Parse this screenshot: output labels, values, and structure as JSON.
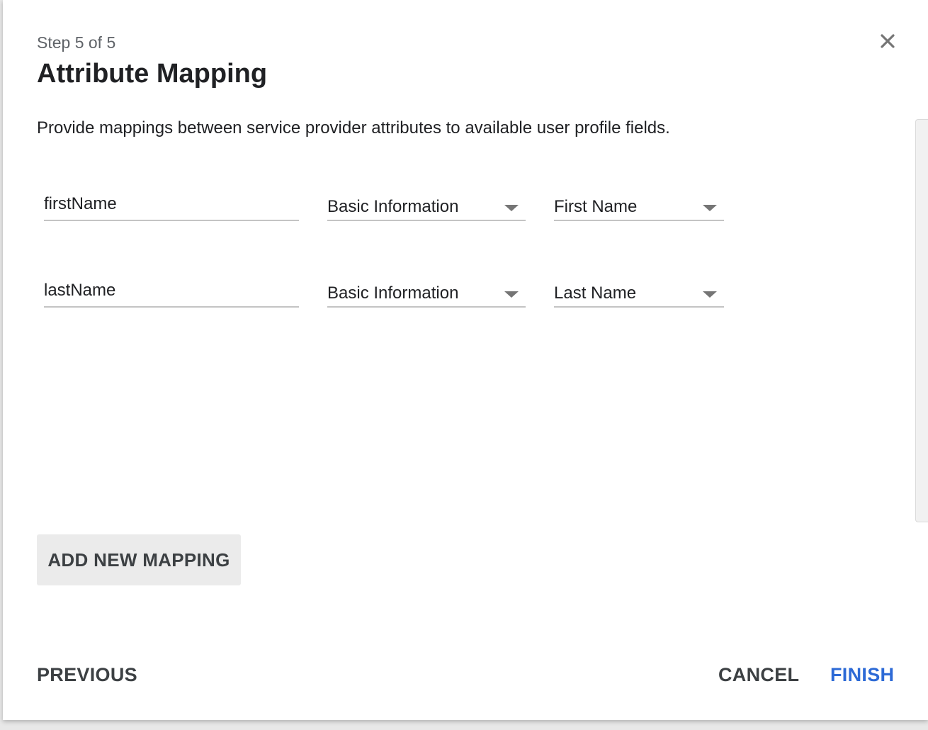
{
  "dialog": {
    "step_label": "Step 5 of 5",
    "title": "Attribute Mapping",
    "description": "Provide mappings between service provider attributes to available user profile fields.",
    "close_icon": "close-icon"
  },
  "mappings": [
    {
      "attribute": "firstName",
      "category": "Basic Information",
      "field": "First Name"
    },
    {
      "attribute": "lastName",
      "category": "Basic Information",
      "field": "Last Name"
    }
  ],
  "buttons": {
    "add_mapping": "ADD NEW MAPPING",
    "previous": "PREVIOUS",
    "cancel": "CANCEL",
    "finish": "FINISH"
  },
  "colors": {
    "accent": "#2d6ad6",
    "underline": "#c4c4c4",
    "secondary_button_bg": "#ebebeb"
  }
}
